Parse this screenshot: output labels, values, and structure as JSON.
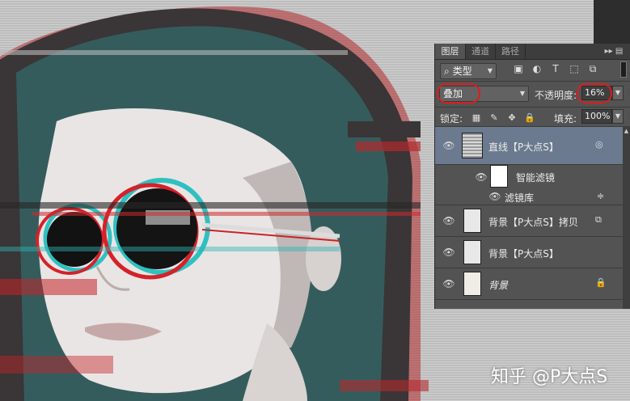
{
  "layers_panel": {
    "tabs": [
      "图层",
      "通道",
      "路径"
    ],
    "filter": {
      "kind_label": "类型"
    },
    "blend_mode": "叠加",
    "opacity": {
      "label": "不透明度:",
      "value": "16%"
    },
    "lock": {
      "label": "锁定:"
    },
    "fill": {
      "label": "填充:",
      "value": "100%"
    },
    "layers": [
      {
        "name": "直线【P大点S】",
        "selected": true
      },
      {
        "name": "智能滤镜"
      },
      {
        "name": "滤镜库"
      },
      {
        "name": "背景【P大点S】拷贝"
      },
      {
        "name": "背景【P大点S】"
      },
      {
        "name": "背景"
      }
    ]
  },
  "watermark": "知乎 @P大点S",
  "colors": {
    "panel_bg": "#535353",
    "selected_layer": "#6b7a8f",
    "highlight_oval": "#e21a1a"
  }
}
